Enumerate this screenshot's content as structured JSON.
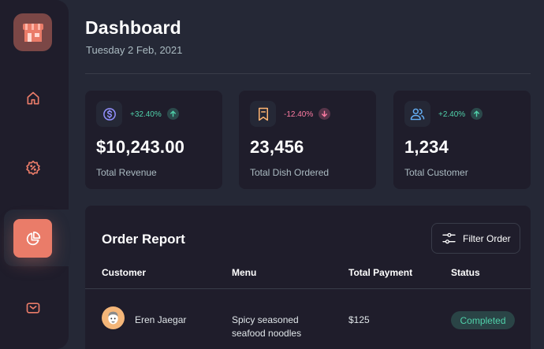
{
  "colors": {
    "accent": "#ea7c69",
    "positive": "#50d1aa",
    "negative": "#ff7ca3",
    "panel": "#1f1d2b",
    "background": "#252836"
  },
  "sidebar": {
    "logo_icon": "store-icon",
    "items": [
      {
        "icon": "home-icon",
        "active": false
      },
      {
        "icon": "discount-icon",
        "active": false
      },
      {
        "icon": "pie-chart-icon",
        "active": true
      },
      {
        "icon": "mail-icon",
        "active": false
      }
    ]
  },
  "header": {
    "title": "Dashboard",
    "date": "Tuesday 2 Feb, 2021"
  },
  "stats": [
    {
      "icon": "dollar-icon",
      "change": "+32.40%",
      "trend": "up",
      "value": "$10,243.00",
      "label": "Total Revenue"
    },
    {
      "icon": "bookmark-icon",
      "change": "-12.40%",
      "trend": "down",
      "value": "23,456",
      "label": "Total Dish Ordered"
    },
    {
      "icon": "users-icon",
      "change": "+2.40%",
      "trend": "up",
      "value": "1,234",
      "label": "Total Customer"
    }
  ],
  "report": {
    "title": "Order Report",
    "filter_label": "Filter Order",
    "columns": [
      "Customer",
      "Menu",
      "Total Payment",
      "Status"
    ],
    "rows": [
      {
        "customer": "Eren Jaegar",
        "menu_line1": "Spicy seasoned",
        "menu_line2": "seafood noodles",
        "payment": "$125",
        "status": "Completed"
      }
    ]
  }
}
